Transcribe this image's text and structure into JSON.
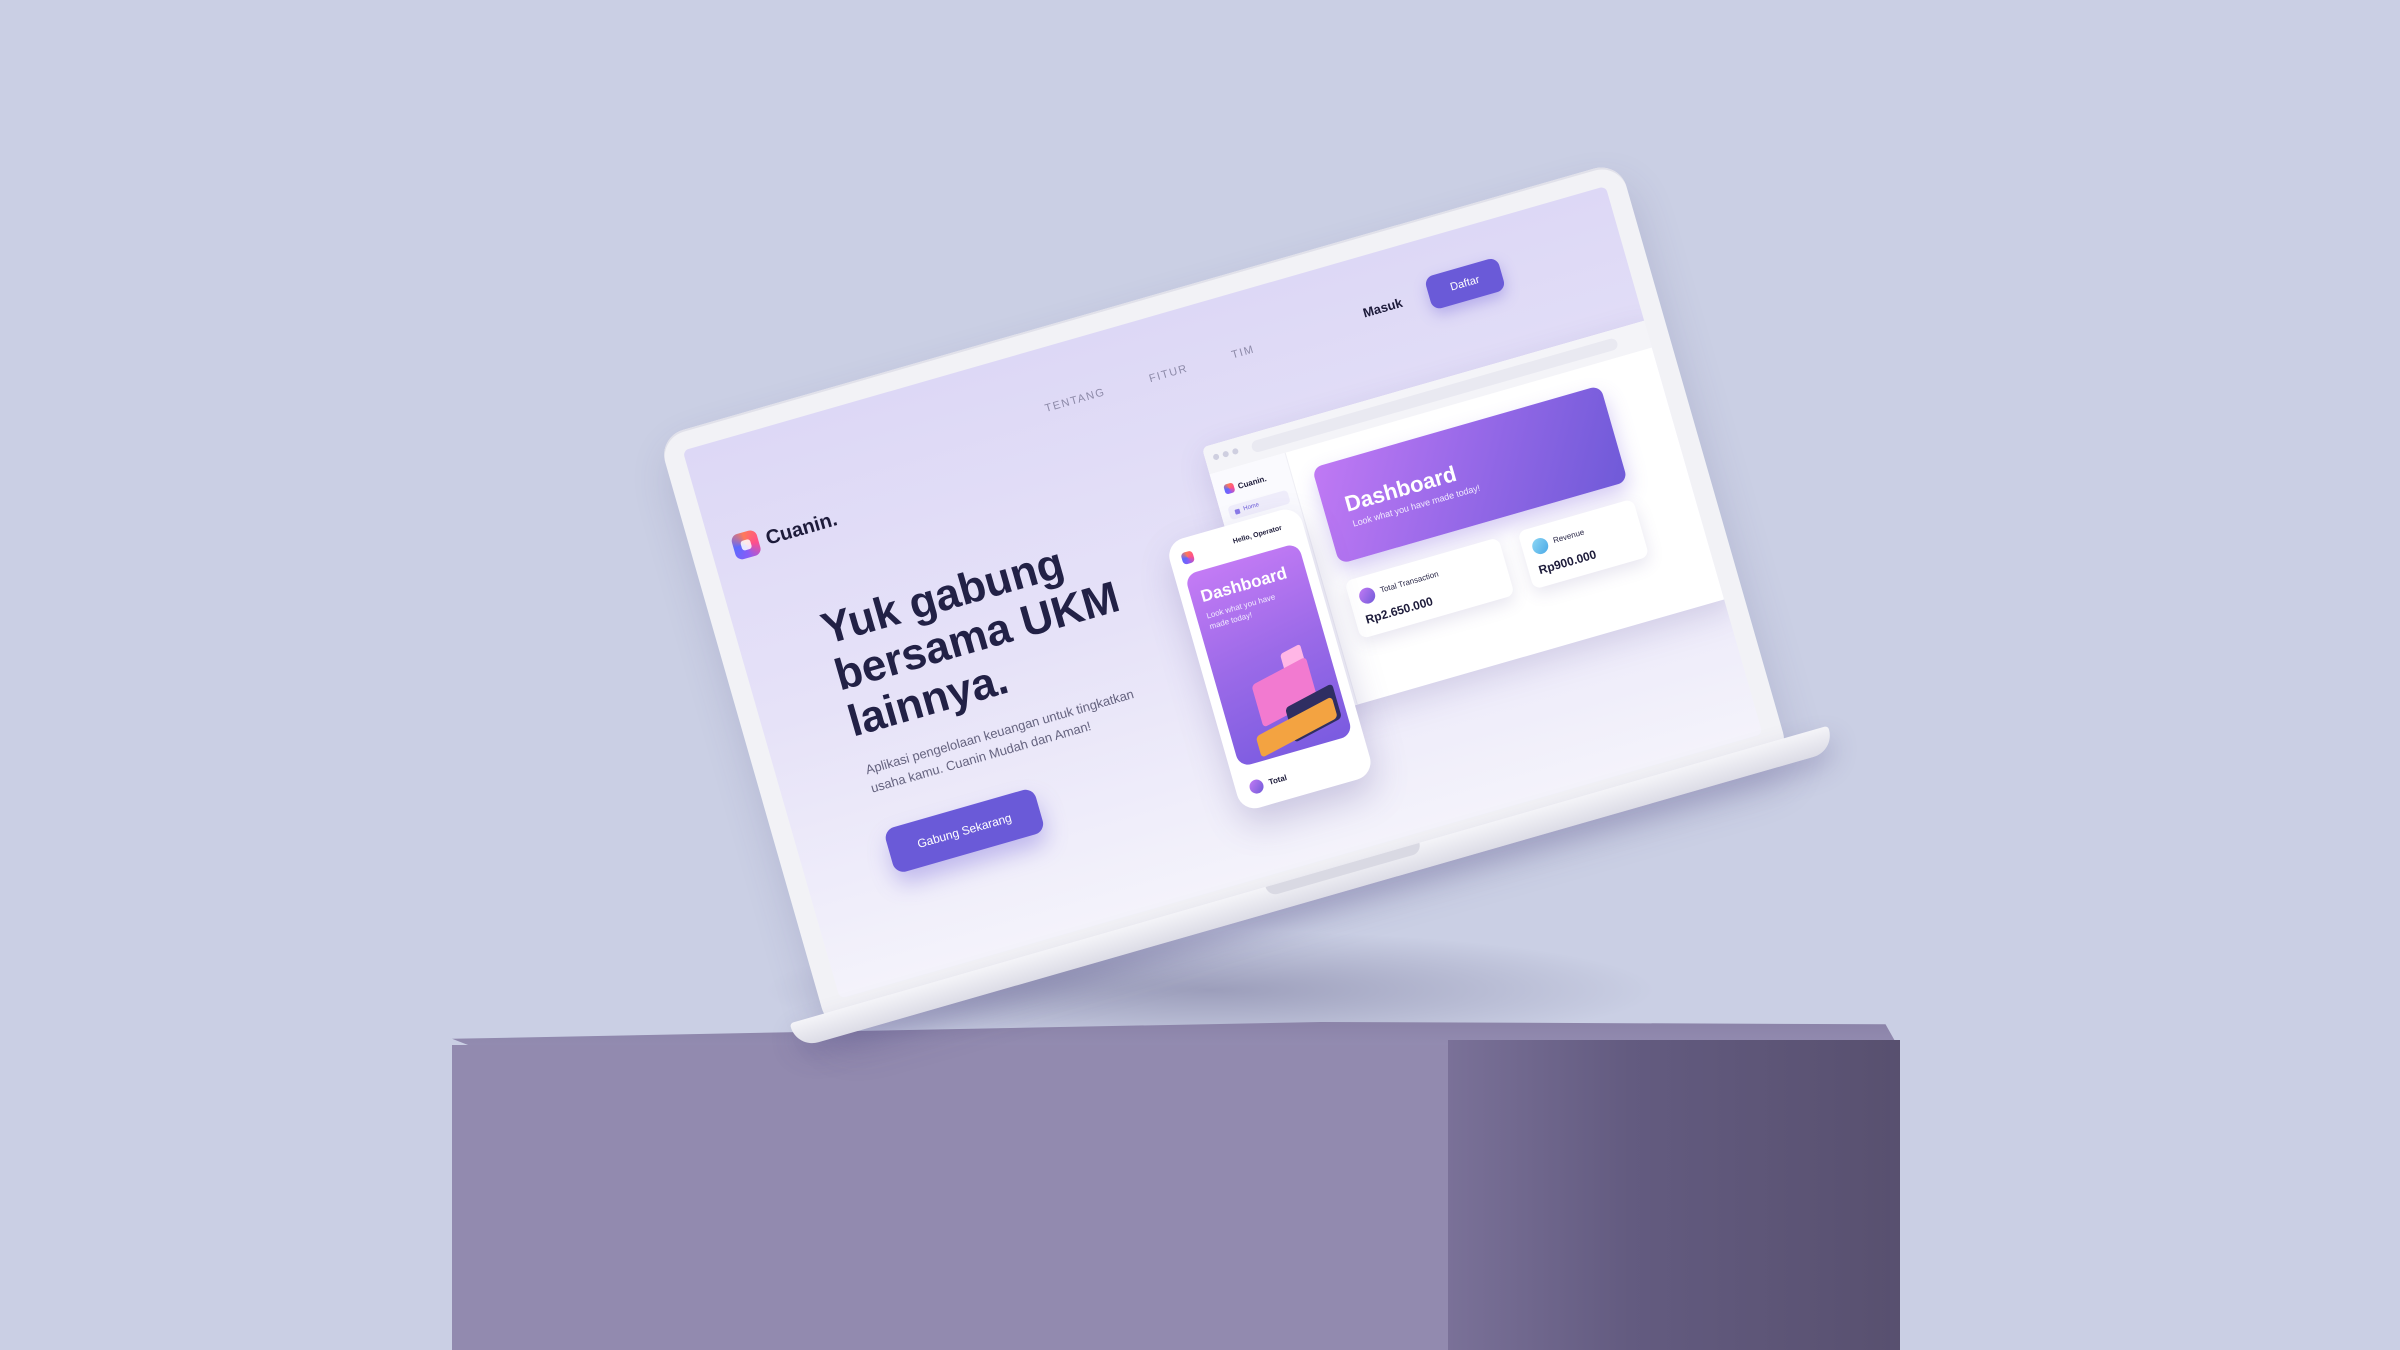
{
  "brand": {
    "name": "Cuanin."
  },
  "nav": {
    "items": [
      "TENTANG",
      "FITUR",
      "TIM"
    ]
  },
  "header": {
    "login_label": "Masuk",
    "register_label": "Daftar"
  },
  "hero": {
    "title": "Yuk gabung bersama UKM lainnya.",
    "subtitle": "Aplikasi pengelolaan keuangan untuk tingkatkan usaha kamu. Cuanin Mudah dan Aman!",
    "cta_label": "Gabung Sekarang"
  },
  "desktop_preview": {
    "brand": "Cuanin.",
    "sidebar_item": "Home",
    "banner_title": "Dashboard",
    "banner_subtitle": "Look what you have made today!",
    "stats": [
      {
        "label": "Total Transaction",
        "value": "Rp2.650.000"
      },
      {
        "label": "Revenue",
        "value": "Rp900.000"
      }
    ]
  },
  "mobile_preview": {
    "greeting": "Hello, Operator",
    "card_title": "Dashboard",
    "card_subtitle": "Look what you have made today!",
    "footer_label": "Total"
  },
  "colors": {
    "accent": "#6a5ad8",
    "background": "#cacfe4",
    "pedestal": "#928aaf",
    "heading": "#222146"
  }
}
